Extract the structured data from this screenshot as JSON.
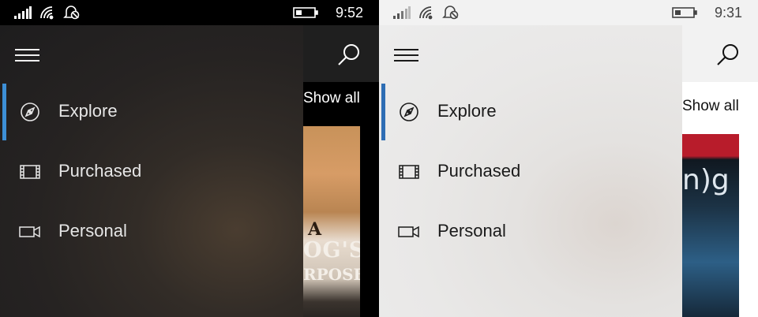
{
  "colors": {
    "accent_dark_theme": "#3d8fd6",
    "accent_light_theme": "#2e6db4"
  },
  "screens": [
    {
      "theme": "dark",
      "status": {
        "time": "9:52",
        "icons": [
          "signal-icon",
          "wifi-icon",
          "quiet-hours-icon",
          "battery-icon"
        ]
      },
      "app_bar": {
        "search_icon": "search-icon"
      },
      "content": {
        "show_all": "Show all",
        "poster_text": [
          "A",
          "OG'S",
          "RPOSE"
        ]
      },
      "nav": {
        "menu_icon": "hamburger-icon",
        "items": [
          {
            "label": "Explore",
            "icon": "compass-icon",
            "selected": true
          },
          {
            "label": "Purchased",
            "icon": "film-strip-icon",
            "selected": false
          },
          {
            "label": "Personal",
            "icon": "video-camera-icon",
            "selected": false
          }
        ]
      }
    },
    {
      "theme": "light",
      "status": {
        "time": "9:31",
        "icons": [
          "signal-icon",
          "wifi-icon",
          "quiet-hours-icon",
          "battery-icon"
        ]
      },
      "app_bar": {
        "search_icon": "search-icon"
      },
      "content": {
        "show_all": "Show all",
        "poster_text": [
          "n)g"
        ]
      },
      "nav": {
        "menu_icon": "hamburger-icon",
        "items": [
          {
            "label": "Explore",
            "icon": "compass-icon",
            "selected": true
          },
          {
            "label": "Purchased",
            "icon": "film-strip-icon",
            "selected": false
          },
          {
            "label": "Personal",
            "icon": "video-camera-icon",
            "selected": false
          }
        ]
      }
    }
  ]
}
